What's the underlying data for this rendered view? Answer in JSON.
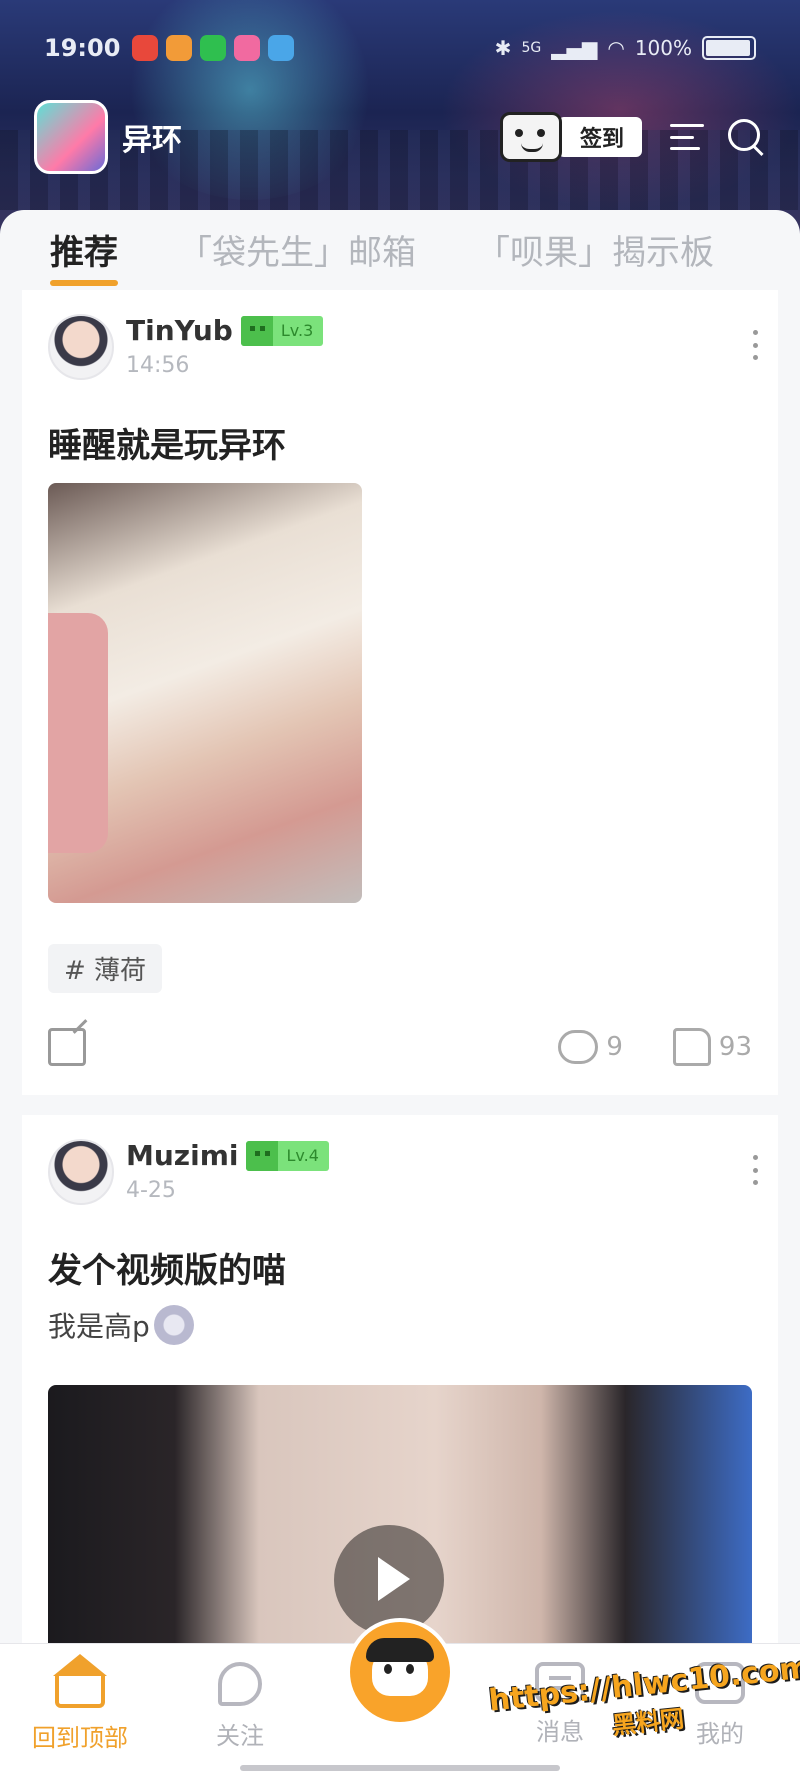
{
  "status_bar": {
    "time": "19:00",
    "network": "5G",
    "battery": "100%"
  },
  "header": {
    "app_name": "异环",
    "checkin_label": "签到"
  },
  "tabs": [
    {
      "label": "推荐",
      "active": true
    },
    {
      "label": "「袋先生」邮箱",
      "active": false
    },
    {
      "label": "「呗果」揭示板",
      "active": false
    }
  ],
  "posts": [
    {
      "username": "TinYub",
      "level": "Lv.3",
      "time": "14:56",
      "title": "睡醒就是玩异环",
      "tag": "# 薄荷",
      "comments": "9",
      "likes": "93",
      "media": "image"
    },
    {
      "username": "Muzimi",
      "level": "Lv.4",
      "time": "4-25",
      "title": "发个视频版的喵",
      "body": "我是高p",
      "media": "video"
    }
  ],
  "bottom_nav": [
    {
      "label": "回到顶部",
      "icon": "home-icon",
      "active": true
    },
    {
      "label": "关注",
      "icon": "follow-icon",
      "active": false
    },
    {
      "label": "消息",
      "icon": "message-icon",
      "active": false
    },
    {
      "label": "我的",
      "icon": "profile-icon",
      "active": false
    }
  ],
  "watermark": {
    "line1": "https://hlwc10.com",
    "line2": "黑料网"
  },
  "colors": {
    "accent": "#f0a12c",
    "level_badge": "#7be27b"
  }
}
